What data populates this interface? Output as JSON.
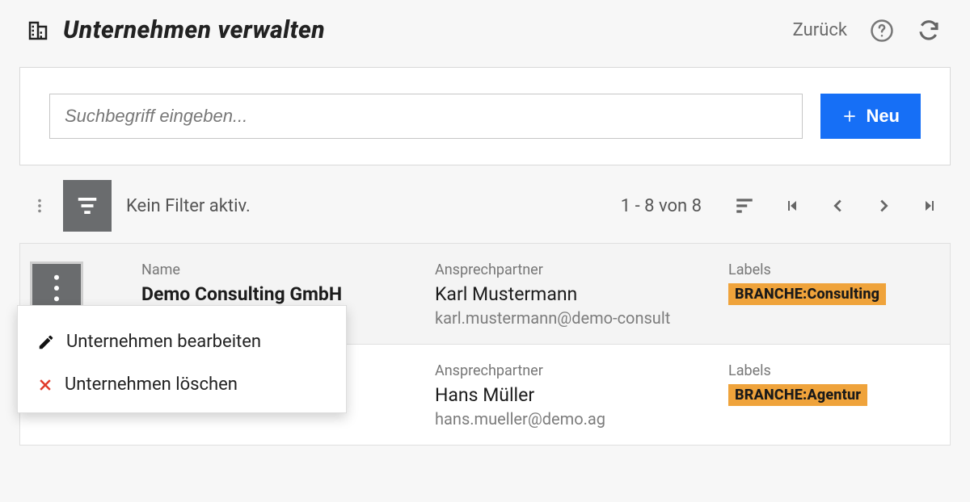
{
  "header": {
    "title": "Unternehmen verwalten",
    "back_label": "Zurück"
  },
  "search": {
    "placeholder": "Suchbegriff eingeben...",
    "new_label": "Neu"
  },
  "toolbar": {
    "filter_status": "Kein Filter aktiv.",
    "pager_text": "1 - 8 von 8"
  },
  "columns": {
    "name": "Name",
    "contact": "Ansprechpartner",
    "labels": "Labels"
  },
  "rows": [
    {
      "name": "Demo Consulting GmbH",
      "contact": "Karl Mustermann",
      "email_truncated": "karl.mustermann@demo-consult",
      "label": "BRANCHE:Consulting"
    },
    {
      "name": "",
      "contact": "Hans Müller",
      "email_truncated": "hans.mueller@demo.ag",
      "label": "BRANCHE:Agentur"
    }
  ],
  "popover": {
    "edit": "Unternehmen bearbeiten",
    "delete": "Unternehmen löschen"
  }
}
